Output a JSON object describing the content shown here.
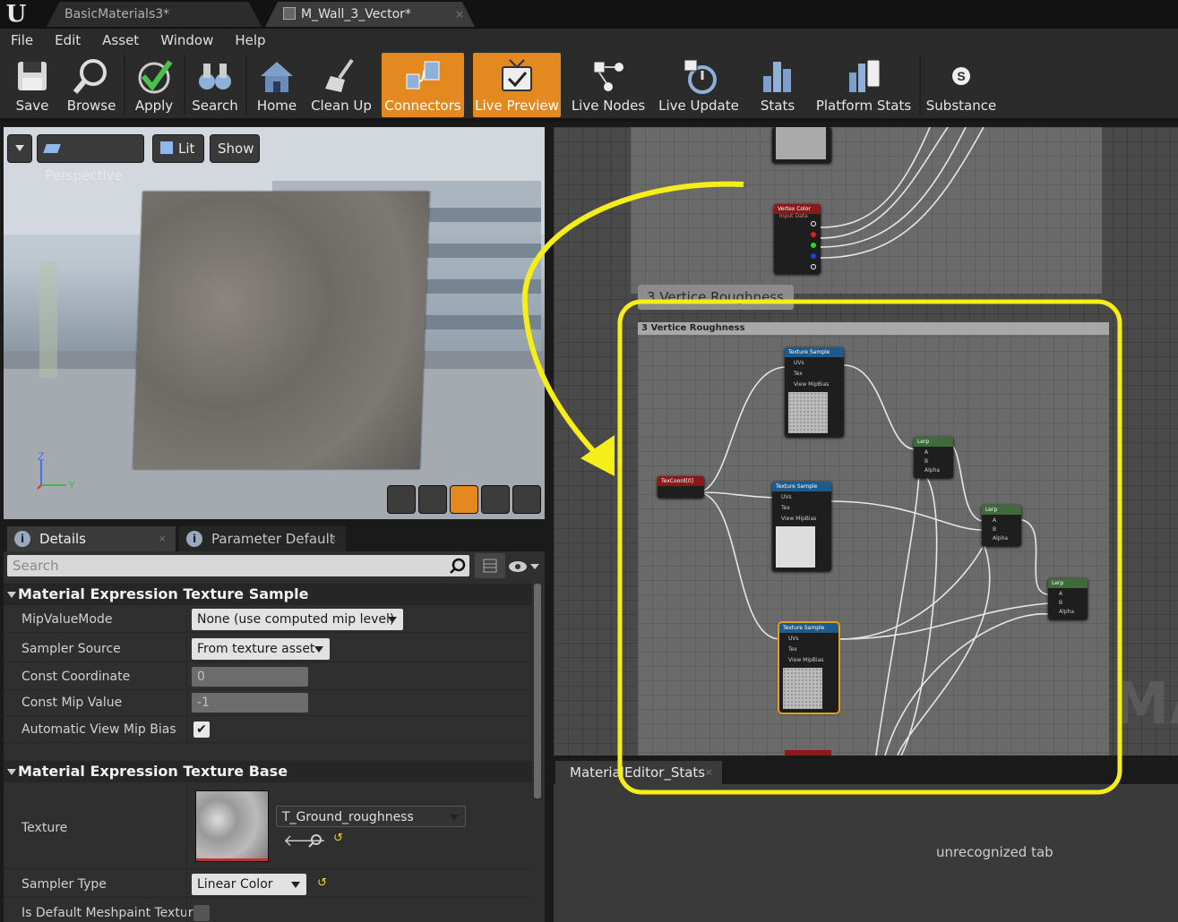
{
  "window": {
    "tabs": [
      {
        "label": "BasicMaterials3*"
      },
      {
        "label": "M_Wall_3_Vector*"
      }
    ],
    "tab_close": "×"
  },
  "menu": [
    "File",
    "Edit",
    "Asset",
    "Window",
    "Help"
  ],
  "toolbar": [
    {
      "label": "Save",
      "icon": "save-icon",
      "active": false
    },
    {
      "label": "Browse",
      "icon": "browse-icon",
      "active": false
    },
    {
      "label": "Apply",
      "icon": "apply-icon",
      "active": false
    },
    {
      "label": "Search",
      "icon": "search-icon",
      "active": false
    },
    {
      "label": "Home",
      "icon": "home-icon",
      "active": false
    },
    {
      "label": "Clean Up",
      "icon": "cleanup-icon",
      "active": false
    },
    {
      "label": "Connectors",
      "icon": "connectors-icon",
      "active": true
    },
    {
      "label": "Live Preview",
      "icon": "live-preview-icon",
      "active": true
    },
    {
      "label": "Live Nodes",
      "icon": "live-nodes-icon",
      "active": false
    },
    {
      "label": "Live Update",
      "icon": "live-update-icon",
      "active": false
    },
    {
      "label": "Stats",
      "icon": "stats-icon",
      "active": false
    },
    {
      "label": "Platform Stats",
      "icon": "platform-stats-icon",
      "active": false
    },
    {
      "label": "Substance",
      "icon": "substance-icon",
      "active": false
    }
  ],
  "viewport": {
    "perspective": "Perspective",
    "lit": "Lit",
    "show": "Show",
    "axis": {
      "z": "Z",
      "y": "Y"
    },
    "accent": "#e3891f"
  },
  "details_panel": {
    "tabs": [
      {
        "label": "Details"
      },
      {
        "label": "Parameter Default"
      }
    ],
    "search_placeholder": "Search",
    "sections": [
      {
        "title": "Material Expression Texture Sample",
        "rows": [
          {
            "label": "MipValueMode",
            "value": "None (use computed mip level)"
          },
          {
            "label": "Sampler Source",
            "value": "From texture asset"
          },
          {
            "label": "Const Coordinate",
            "value": "0"
          },
          {
            "label": "Const Mip Value",
            "value": "-1"
          },
          {
            "label": "Automatic View Mip Bias",
            "value": "✔"
          }
        ]
      },
      {
        "title": "Material Expression Texture Base",
        "rows": [
          {
            "label": "Texture",
            "value": "T_Ground_roughness"
          },
          {
            "label": "Sampler Type",
            "value": "Linear Color"
          },
          {
            "label": "Is Default Meshpaint Textur",
            "value": ""
          }
        ]
      }
    ]
  },
  "graph": {
    "comment_upper_bubble": "3 Vertice Roughness",
    "comment_header": "3 Vertice Roughness",
    "vertex_color_node": {
      "title": "Vertex Color",
      "subtitle": "Input Data"
    },
    "texcoord_node": {
      "title": "TexCoord[0]"
    },
    "texture_sample_nodes": [
      {
        "title": "Texture Sample",
        "pins": [
          "UVs",
          "Tex",
          "View MipBias"
        ]
      },
      {
        "title": "Texture Sample",
        "pins": [
          "UVs",
          "Tex",
          "View MipBias"
        ]
      },
      {
        "title": "Texture Sample",
        "pins": [
          "UVs",
          "Tex",
          "View MipBias"
        ]
      }
    ],
    "lerp_nodes": [
      {
        "title": "Lerp",
        "pins": [
          "A",
          "B",
          "Alpha"
        ]
      },
      {
        "title": "Lerp",
        "pins": [
          "A",
          "B",
          "Alpha"
        ]
      },
      {
        "title": "Lerp",
        "pins": [
          "A",
          "B",
          "Alpha"
        ]
      }
    ],
    "watermark": "MA",
    "highlight_color": "#f5ee1a"
  },
  "stats_panel": {
    "tab": "MaterialEditor_Stats",
    "message": "unrecognized tab"
  }
}
